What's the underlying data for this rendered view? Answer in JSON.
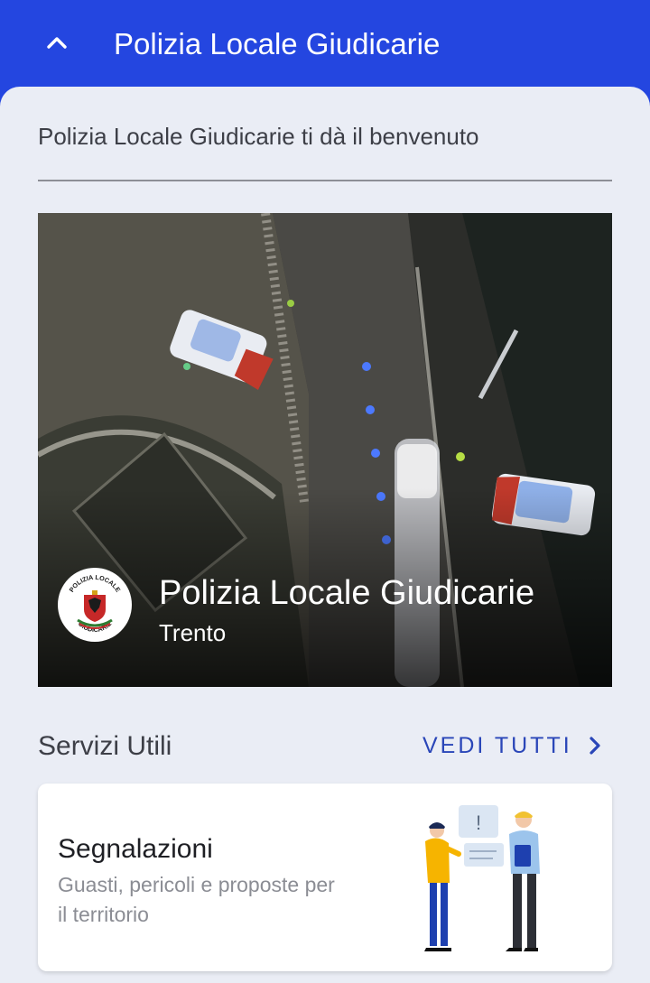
{
  "app_bar": {
    "title": "Polizia Locale Giudicarie",
    "back_icon": "chevron-up-icon"
  },
  "welcome": {
    "text": "Polizia Locale Giudicarie ti dà il benvenuto"
  },
  "hero": {
    "title": "Polizia Locale Giudicarie",
    "subtitle": "Trento",
    "logo_text_top": "POLIZIA LOCALE",
    "logo_text_bottom": "GIUDICARIE"
  },
  "services": {
    "heading": "Servizi Utili",
    "see_all_label": "VEDI TUTTI",
    "see_all_icon": "chevron-right-icon",
    "items": [
      {
        "title": "Segnalazioni",
        "description": "Guasti, pericoli e proposte per il territorio"
      }
    ]
  },
  "colors": {
    "primary": "#2446e0",
    "accent_link": "#2a46b8",
    "background": "#eaedf5"
  }
}
